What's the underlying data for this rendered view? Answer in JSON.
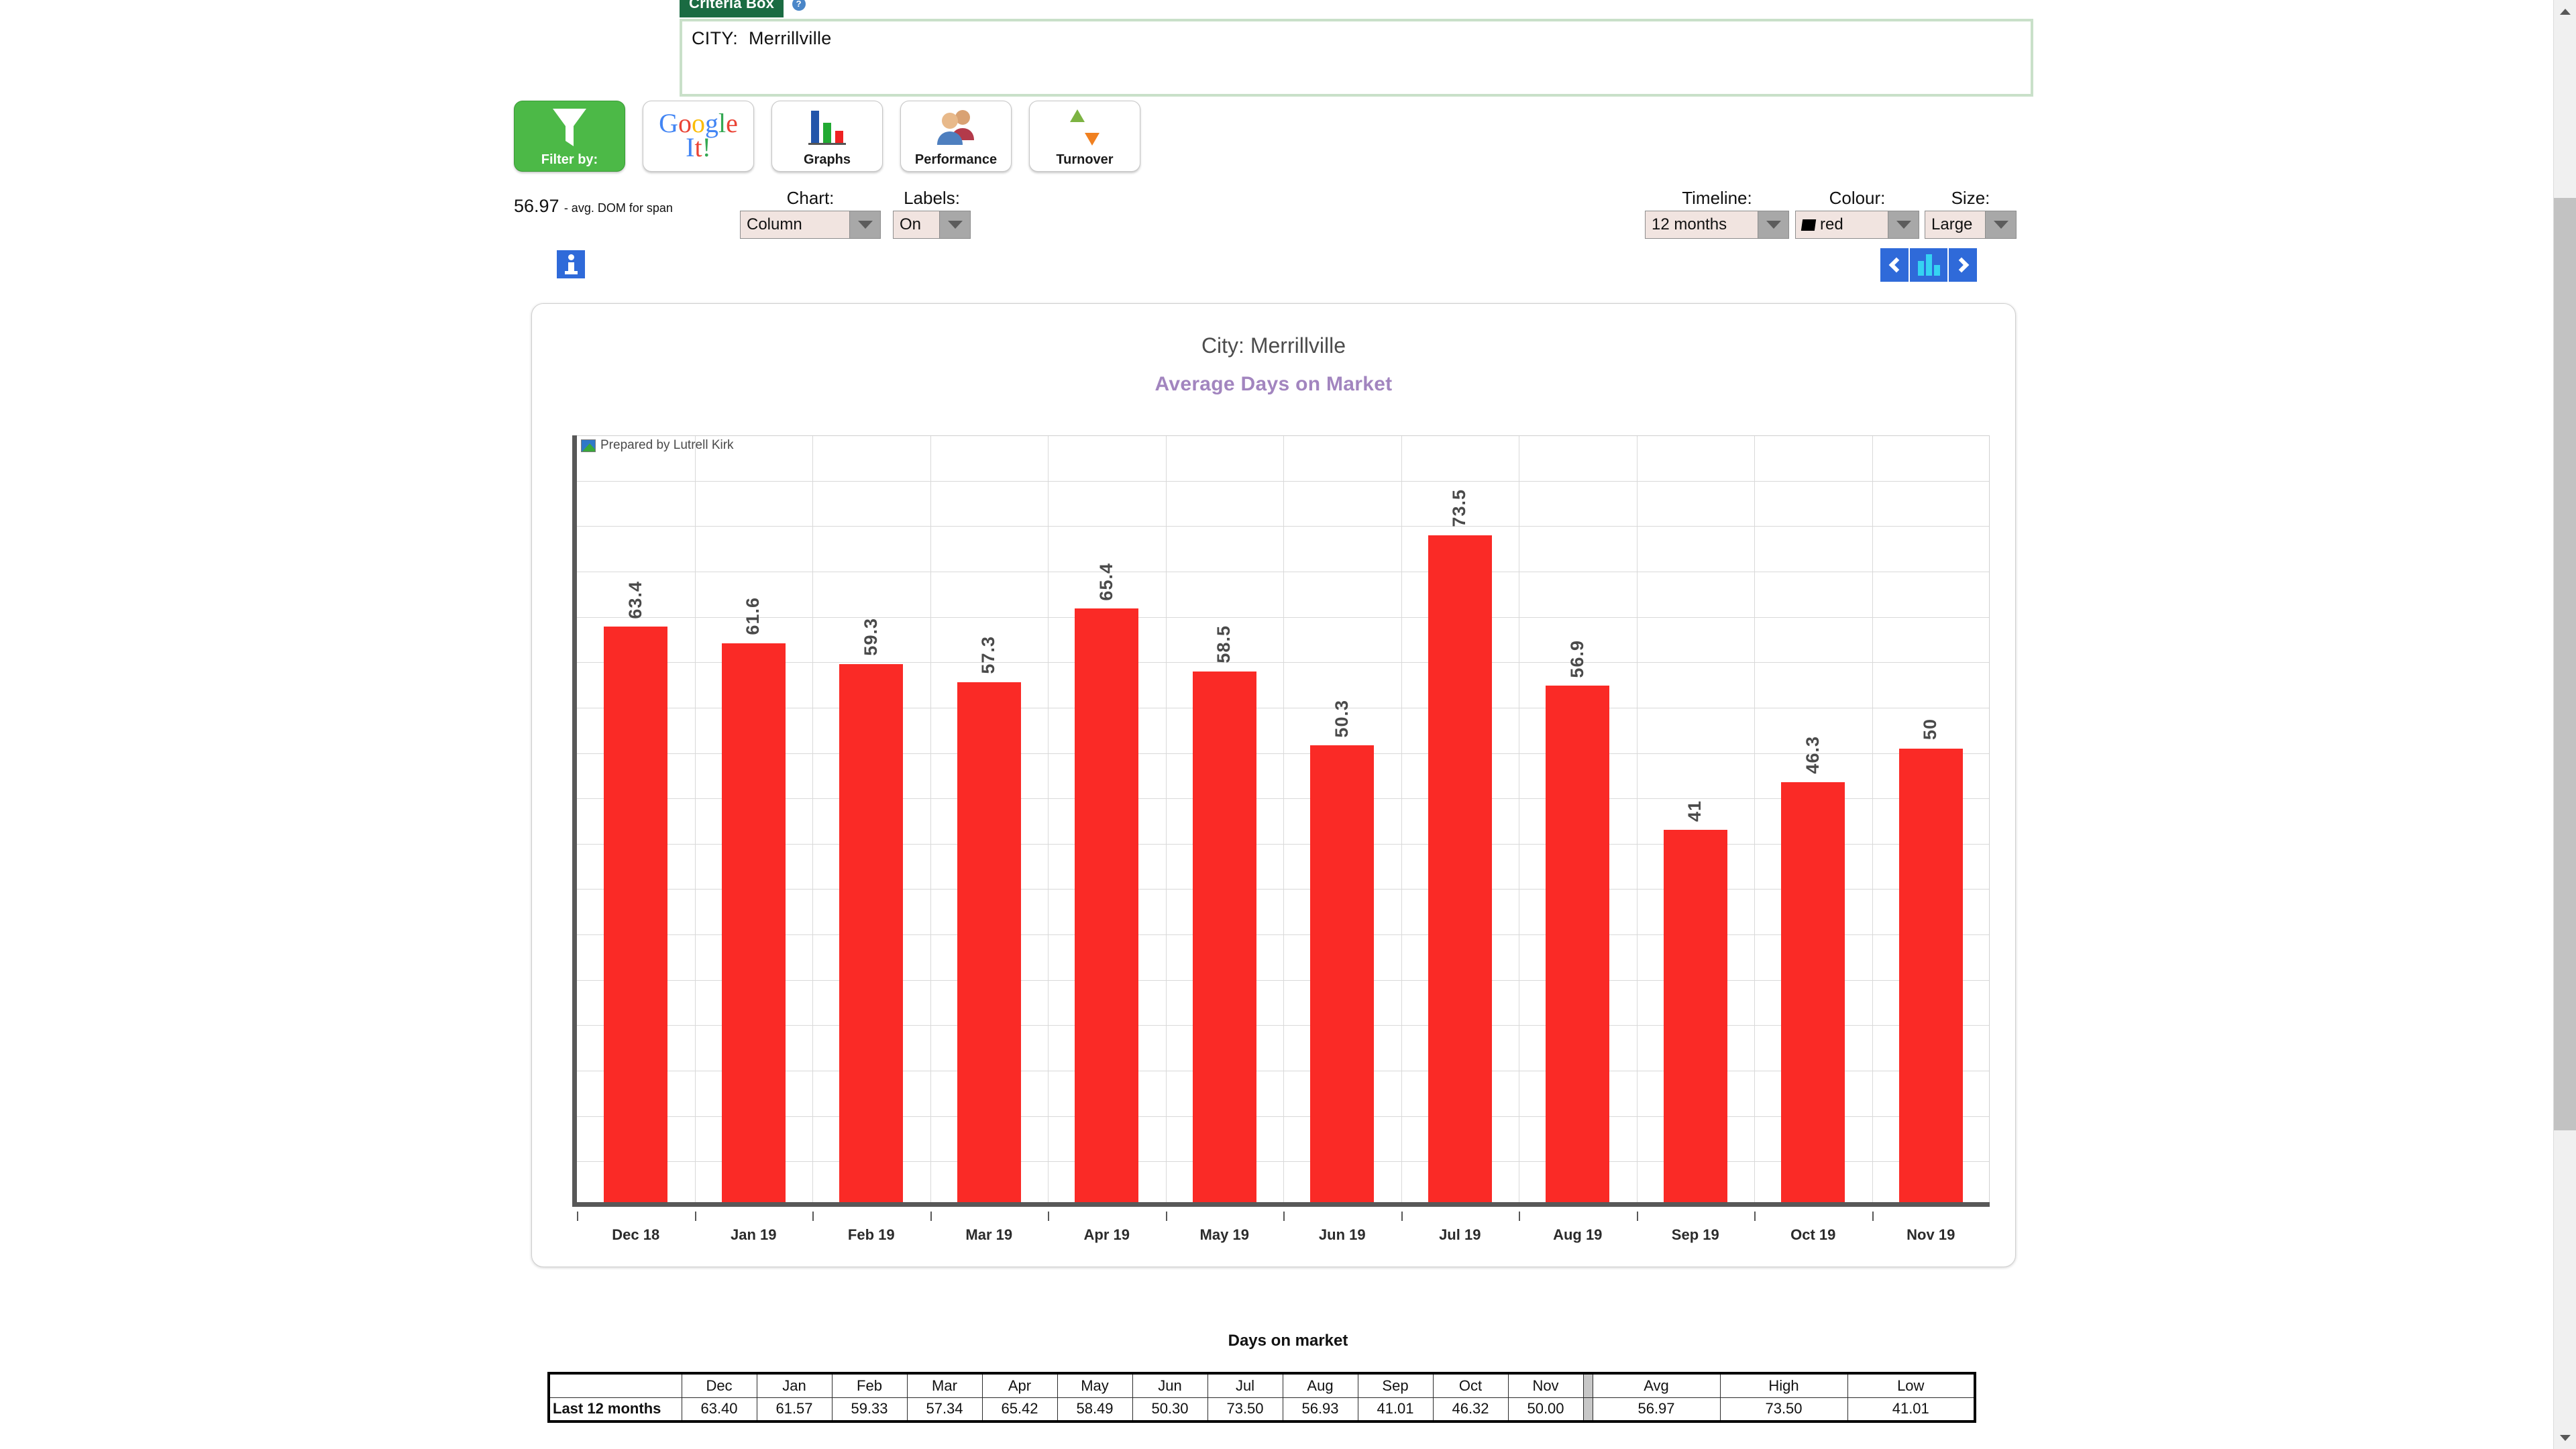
{
  "criteria": {
    "tab_label": "Criteria Box",
    "help_icon": "question-mark-icon",
    "field_label": "CITY:",
    "field_value": "Merrillville"
  },
  "toolbar": [
    {
      "id": "filter",
      "label": "Filter by:",
      "icon": "funnel-icon"
    },
    {
      "id": "google",
      "label": "",
      "icon": "google-it-icon"
    },
    {
      "id": "graphs",
      "label": "Graphs",
      "icon": "bar-chart-icon"
    },
    {
      "id": "performance",
      "label": "Performance",
      "icon": "people-icon"
    },
    {
      "id": "turnover",
      "label": "Turnover",
      "icon": "up-down-arrows-icon"
    }
  ],
  "google_btn": {
    "line1": "Google",
    "line2": "It!"
  },
  "summary": {
    "value": "56.97",
    "suffix": "- avg. DOM for span"
  },
  "controls": {
    "chart": {
      "label": "Chart:",
      "value": "Column"
    },
    "labels": {
      "label": "Labels:",
      "value": "On"
    },
    "timeline": {
      "label": "Timeline:",
      "value": "12 months"
    },
    "colour": {
      "label": "Colour:",
      "value": "red",
      "swatch": "#000000"
    },
    "size": {
      "label": "Size:",
      "value": "Large"
    }
  },
  "pager": {
    "prev_icon": "chevron-left-icon",
    "chart_icon": "bar-chart-icon",
    "next_icon": "chevron-right-icon",
    "info_icon": "info-icon"
  },
  "chart_card": {
    "title": "City: Merrillville",
    "subtitle": "Average Days on Market",
    "subtitle_color": "#a285bf",
    "prepared_by": "Prepared by Lutrell Kirk",
    "prepared_icon": "image-thumbnail-icon"
  },
  "chart_data": {
    "type": "bar",
    "title": "City: Merrillville",
    "subtitle": "Average Days on Market",
    "xlabel": "",
    "ylabel": "",
    "ylim": [
      0,
      85
    ],
    "grid": true,
    "legend": "none",
    "series_color": "#fa2a26",
    "categories": [
      "Dec 18",
      "Jan 19",
      "Feb 19",
      "Mar 19",
      "Apr 19",
      "May 19",
      "Jun 19",
      "Jul 19",
      "Aug 19",
      "Sep 19",
      "Oct 19",
      "Nov 19"
    ],
    "values": [
      63.4,
      61.6,
      59.3,
      57.3,
      65.4,
      58.5,
      50.3,
      73.5,
      56.9,
      41,
      46.3,
      50
    ],
    "data_labels": [
      "63.4",
      "61.6",
      "59.3",
      "57.3",
      "65.4",
      "58.5",
      "50.3",
      "73.5",
      "56.9",
      "41",
      "46.3",
      "50"
    ],
    "data_label_orientation": "vertical"
  },
  "table": {
    "title": "Days on market",
    "columns": [
      "",
      "Dec",
      "Jan",
      "Feb",
      "Mar",
      "Apr",
      "May",
      "Jun",
      "Jul",
      "Aug",
      "Sep",
      "Oct",
      "Nov",
      "",
      "Avg",
      "High",
      "Low"
    ],
    "rows": [
      {
        "label": "Last 12 months",
        "months": [
          "63.40",
          "61.57",
          "59.33",
          "57.34",
          "65.42",
          "58.49",
          "50.30",
          "73.50",
          "56.93",
          "41.01",
          "46.32",
          "50.00"
        ],
        "stats": [
          "56.97",
          "73.50",
          "41.01"
        ]
      }
    ]
  },
  "scrollbar": {
    "up_icon": "triangle-up-icon",
    "down_icon": "triangle-down-icon"
  }
}
